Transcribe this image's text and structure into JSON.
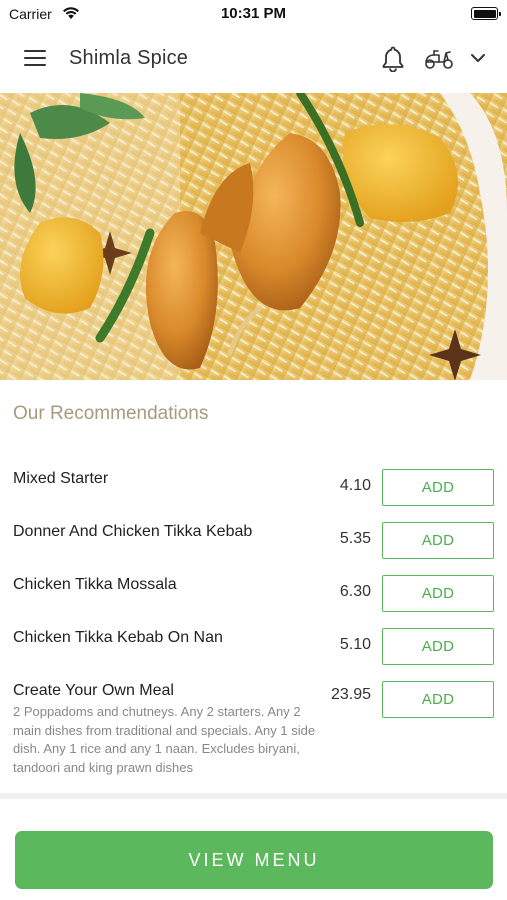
{
  "status_bar": {
    "carrier": "Carrier",
    "time": "10:31 PM"
  },
  "header": {
    "title": "Shimla Spice",
    "icons": [
      "menu-icon",
      "bell-icon",
      "scooter-icon",
      "chevron-down-icon"
    ]
  },
  "hero": {
    "image": "biryani-dish-photo"
  },
  "recommendations": {
    "title": "Our Recommendations",
    "items": [
      {
        "name": "Mixed Starter",
        "price": "4.10",
        "add_label": "ADD"
      },
      {
        "name": "Donner And Chicken Tikka Kebab",
        "price": "5.35",
        "add_label": "ADD"
      },
      {
        "name": "Chicken Tikka Mossala",
        "price": "6.30",
        "add_label": "ADD"
      },
      {
        "name": "Chicken Tikka Kebab On Nan",
        "price": "5.10",
        "add_label": "ADD"
      },
      {
        "name": "Create Your Own Meal",
        "price": "23.95",
        "add_label": "ADD",
        "description": "2 Poppadoms and chutneys. Any 2 starters. Any 2 main dishes from traditional and specials. Any 1 side dish. Any 1 rice and any 1 naan. Excludes biryani, tandoori and king prawn dishes"
      }
    ]
  },
  "footer": {
    "view_menu_label": "VIEW MENU"
  },
  "colors": {
    "accent": "#5cb85c",
    "section_title": "#a89a7e",
    "description": "#888888"
  }
}
